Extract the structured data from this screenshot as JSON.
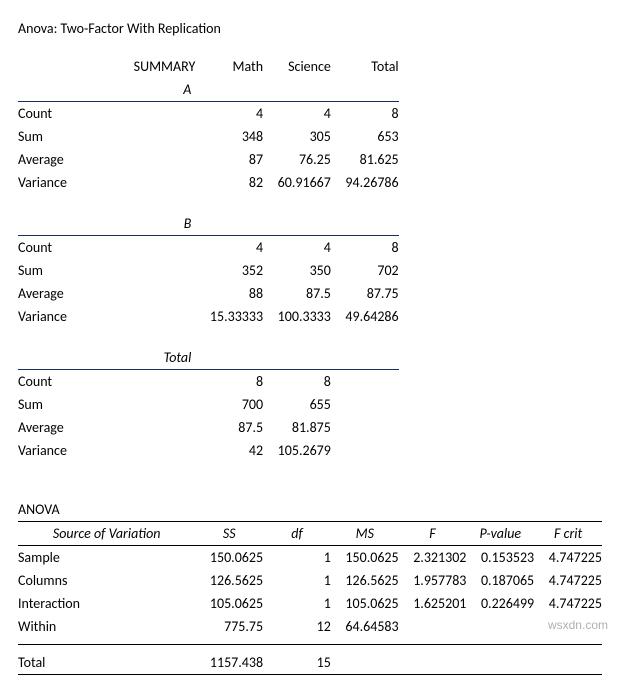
{
  "title": "Anova: Two-Factor With Replication",
  "summary_label": "SUMMARY",
  "cols": {
    "c1": "Math",
    "c2": "Science",
    "c3": "Total"
  },
  "groups": {
    "a": {
      "name": "A",
      "count": {
        "label": "Count",
        "c1": "4",
        "c2": "4",
        "c3": "8"
      },
      "sum": {
        "label": "Sum",
        "c1": "348",
        "c2": "305",
        "c3": "653"
      },
      "average": {
        "label": "Average",
        "c1": "87",
        "c2": "76.25",
        "c3": "81.625"
      },
      "variance": {
        "label": "Variance",
        "c1": "82",
        "c2": "60.91667",
        "c3": "94.26786"
      }
    },
    "b": {
      "name": "B",
      "count": {
        "label": "Count",
        "c1": "4",
        "c2": "4",
        "c3": "8"
      },
      "sum": {
        "label": "Sum",
        "c1": "352",
        "c2": "350",
        "c3": "702"
      },
      "average": {
        "label": "Average",
        "c1": "88",
        "c2": "87.5",
        "c3": "87.75"
      },
      "variance": {
        "label": "Variance",
        "c1": "15.33333",
        "c2": "100.3333",
        "c3": "49.64286"
      }
    },
    "total": {
      "name": "Total",
      "count": {
        "label": "Count",
        "c1": "8",
        "c2": "8"
      },
      "sum": {
        "label": "Sum",
        "c1": "700",
        "c2": "655"
      },
      "average": {
        "label": "Average",
        "c1": "87.5",
        "c2": "81.875"
      },
      "variance": {
        "label": "Variance",
        "c1": "42",
        "c2": "105.2679"
      }
    }
  },
  "anova_label": "ANOVA",
  "anova_cols": {
    "src": "Source of Variation",
    "ss": "SS",
    "df": "df",
    "ms": "MS",
    "f": "F",
    "p": "P-value",
    "fcrit": "F crit"
  },
  "anova": {
    "sample": {
      "label": "Sample",
      "ss": "150.0625",
      "df": "1",
      "ms": "150.0625",
      "f": "2.321302",
      "p": "0.153523",
      "fcrit": "4.747225"
    },
    "columns": {
      "label": "Columns",
      "ss": "126.5625",
      "df": "1",
      "ms": "126.5625",
      "f": "1.957783",
      "p": "0.187065",
      "fcrit": "4.747225"
    },
    "interaction": {
      "label": "Interaction",
      "ss": "105.0625",
      "df": "1",
      "ms": "105.0625",
      "f": "1.625201",
      "p": "0.226499",
      "fcrit": "4.747225"
    },
    "within": {
      "label": "Within",
      "ss": "775.75",
      "df": "12",
      "ms": "64.64583"
    },
    "total": {
      "label": "Total",
      "ss": "1157.438",
      "df": "15"
    }
  },
  "watermark": "wsxdn.com"
}
